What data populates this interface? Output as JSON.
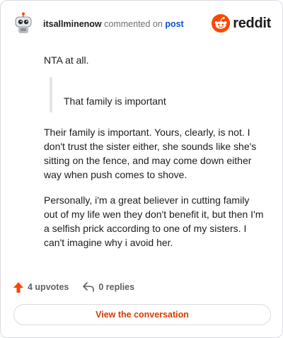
{
  "header": {
    "username": "itsallminenow",
    "action_text": "commented on",
    "post_link_label": "post",
    "brand_name": "reddit"
  },
  "comment": {
    "opening": "NTA at all.",
    "quote": "That family is important",
    "paragraph_2": "Their family is important. Yours, clearly, is not. I don't trust the sister either, she sounds like she's sitting on the fence, and may come down either way when push comes to shove.",
    "paragraph_3": "Personally, i'm a great believer in cutting family out of my life wen they don't benefit it, but then I'm a selfish prick according to one of my sisters. I can't imagine why i avoid her."
  },
  "stats": {
    "upvotes_label": "4 upvotes",
    "replies_label": "0 replies"
  },
  "cta": {
    "label": "View the conversation"
  },
  "colors": {
    "brand_orange": "#ff4500",
    "link_blue": "#0a4fd6",
    "cta_text": "#d93a00",
    "border": "#d9dcdf",
    "quote_bar": "#e3e5e8"
  },
  "icons": {
    "avatar": "snoo-avatar-icon",
    "brand": "reddit-logo-icon",
    "upvote": "upvote-arrow-icon",
    "reply": "reply-arrow-icon"
  }
}
